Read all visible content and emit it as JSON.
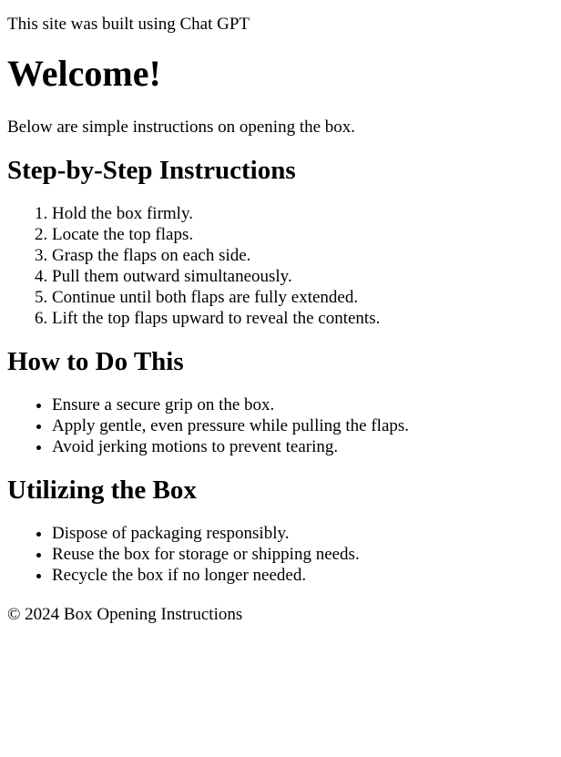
{
  "top_note": "This site was built using Chat GPT",
  "welcome": {
    "title": "Welcome!",
    "intro": "Below are simple instructions on opening the box."
  },
  "steps": {
    "heading": "Step-by-Step Instructions",
    "items": [
      "Hold the box firmly.",
      "Locate the top flaps.",
      "Grasp the flaps on each side.",
      "Pull them outward simultaneously.",
      "Continue until both flaps are fully extended.",
      "Lift the top flaps upward to reveal the contents."
    ]
  },
  "how_to": {
    "heading": "How to Do This",
    "items": [
      "Ensure a secure grip on the box.",
      "Apply gentle, even pressure while pulling the flaps.",
      "Avoid jerking motions to prevent tearing."
    ]
  },
  "utilizing": {
    "heading": "Utilizing the Box",
    "items": [
      "Dispose of packaging responsibly.",
      "Reuse the box for storage or shipping needs.",
      "Recycle the box if no longer needed."
    ]
  },
  "footer": "© 2024 Box Opening Instructions"
}
